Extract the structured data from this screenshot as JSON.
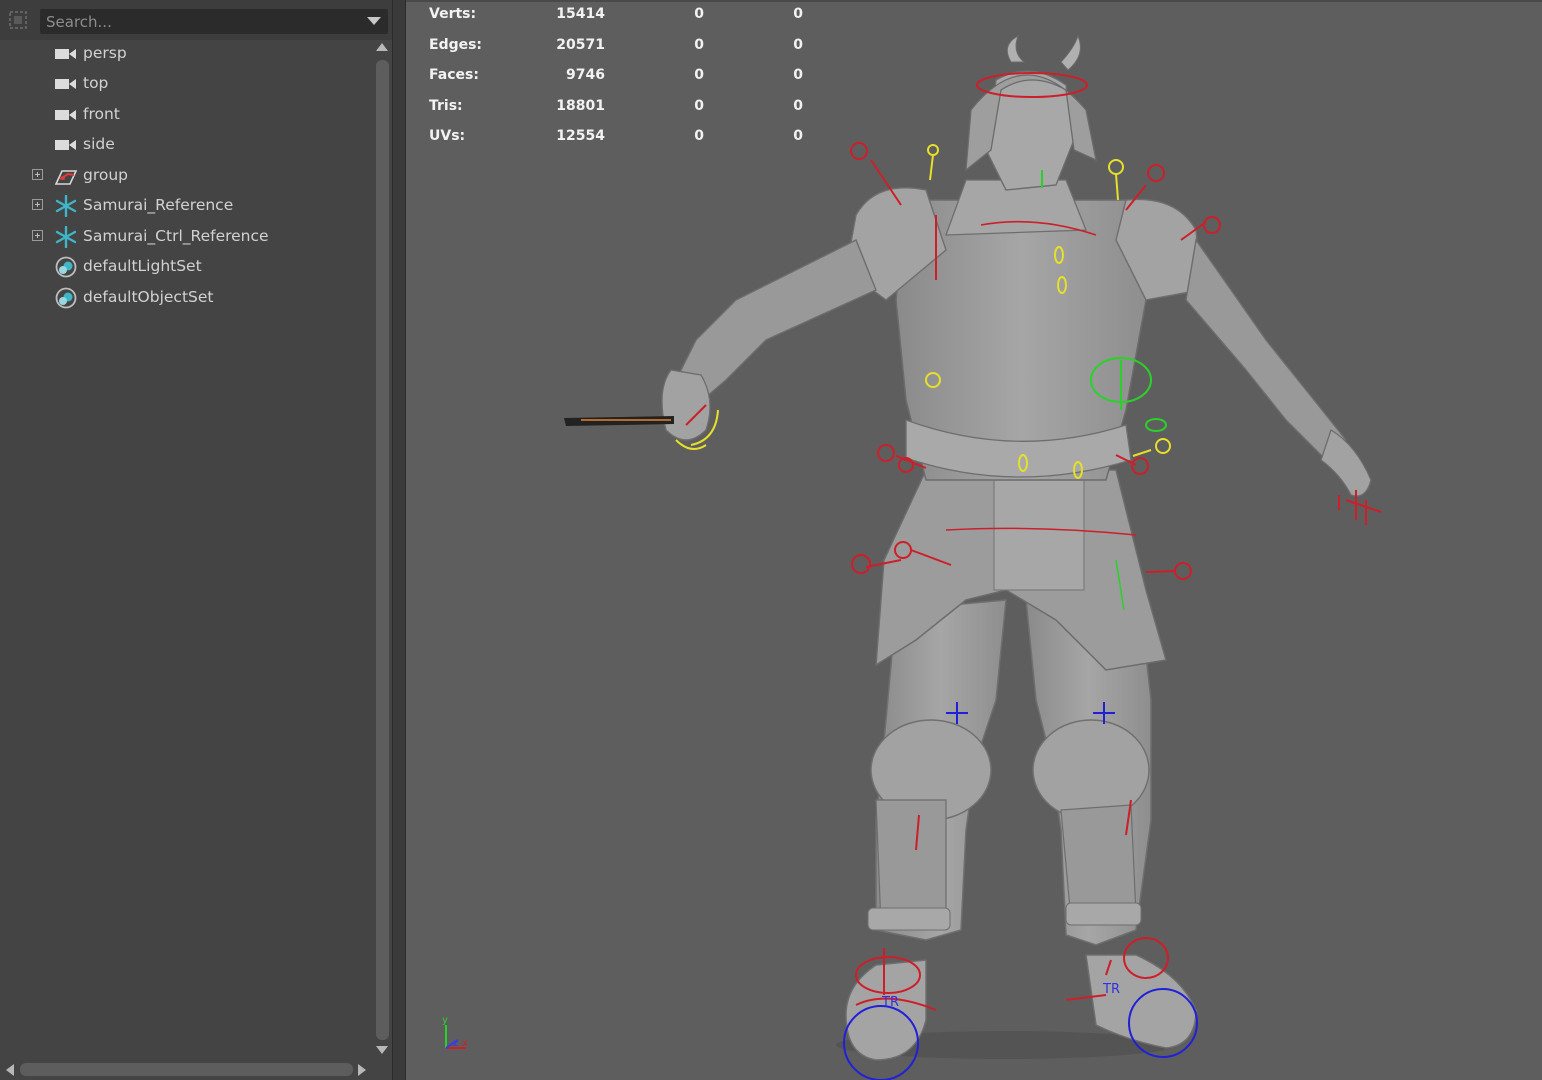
{
  "outliner": {
    "search_placeholder": "Search...",
    "items": [
      {
        "label": "persp",
        "icon": "camera-icon",
        "expandable": false
      },
      {
        "label": "top",
        "icon": "camera-icon",
        "expandable": false
      },
      {
        "label": "front",
        "icon": "camera-icon",
        "expandable": false
      },
      {
        "label": "side",
        "icon": "camera-icon",
        "expandable": false
      },
      {
        "label": "group",
        "icon": "group-transform-icon",
        "expandable": true
      },
      {
        "label": "Samurai_Reference",
        "icon": "reference-icon",
        "expandable": true
      },
      {
        "label": "Samurai_Ctrl_Reference",
        "icon": "reference-icon",
        "expandable": true
      },
      {
        "label": "defaultLightSet",
        "icon": "set-icon",
        "expandable": false
      },
      {
        "label": "defaultObjectSet",
        "icon": "set-icon",
        "expandable": false
      }
    ]
  },
  "hud": {
    "rows": [
      {
        "label": "Verts:",
        "total": "15414",
        "selected": "0",
        "selected_components": "0"
      },
      {
        "label": "Edges:",
        "total": "20571",
        "selected": "0",
        "selected_components": "0"
      },
      {
        "label": "Faces:",
        "total": "9746",
        "selected": "0",
        "selected_components": "0"
      },
      {
        "label": "Tris:",
        "total": "18801",
        "selected": "0",
        "selected_components": "0"
      },
      {
        "label": "UVs:",
        "total": "12554",
        "selected": "0",
        "selected_components": "0"
      }
    ]
  },
  "viewport": {
    "foot_labels": [
      "TR",
      "TR"
    ],
    "axis_labels": {
      "y": "y",
      "z": "z",
      "x": "x"
    },
    "colors": {
      "background": "#5e5e5e",
      "model": "#9a9a9a",
      "ctrl_red": "#cc1f2a",
      "ctrl_yellow": "#e6e02a",
      "ctrl_green": "#2bd12b",
      "ctrl_blue": "#2020d8"
    }
  }
}
